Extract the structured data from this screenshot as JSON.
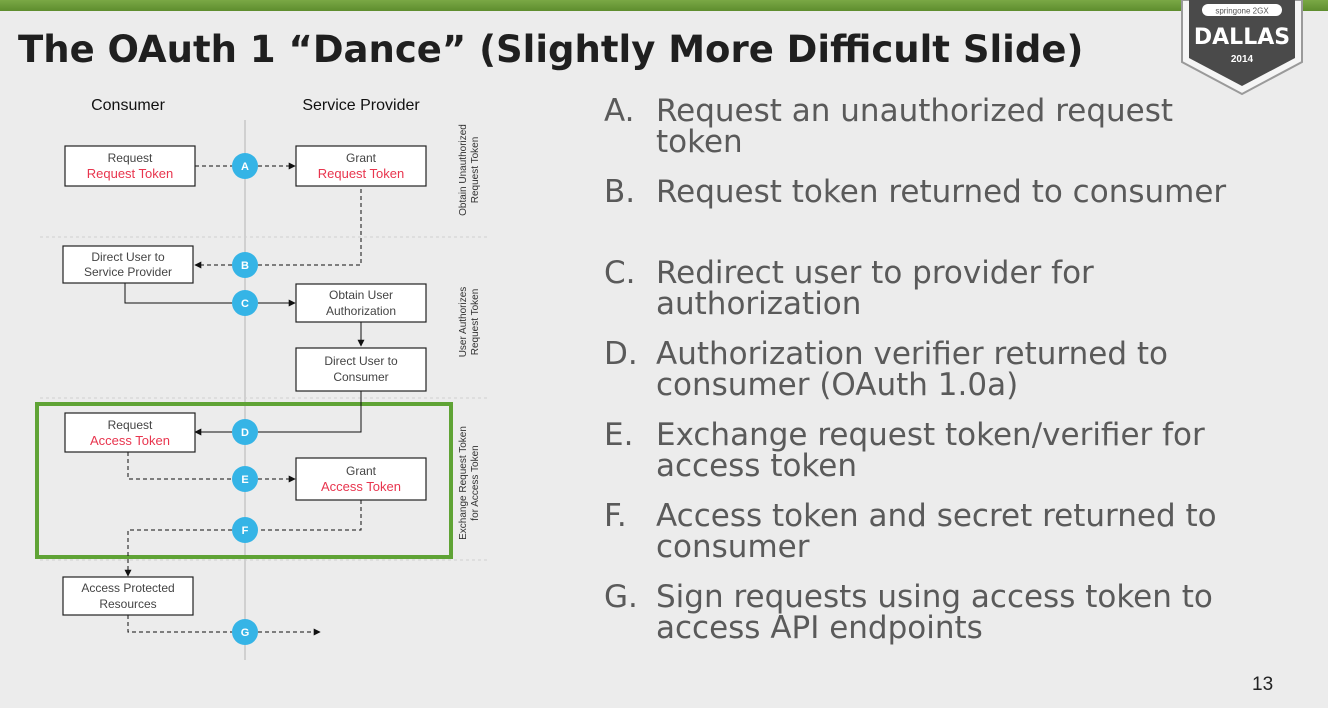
{
  "slide": {
    "title": "The OAuth 1 “Dance” (Slightly More Difficult Slide)",
    "page_number": "13",
    "badge": {
      "top_text": "springone 2GX",
      "city": "DALLAS",
      "year": "2014"
    }
  },
  "diagram": {
    "columns": {
      "left": "Consumer",
      "right": "Service Provider"
    },
    "phases": {
      "obtain": [
        "Obtain Unauthorized",
        "Request Token"
      ],
      "authorize": [
        "User Authorizes",
        "Request Token"
      ],
      "exchange": [
        "Exchange Request Token",
        "for Access Token"
      ]
    },
    "boxes": {
      "request_request_token": [
        "Request",
        "Request Token"
      ],
      "grant_request_token": [
        "Grant",
        "Request Token"
      ],
      "direct_to_sp": [
        "Direct User to",
        "Service Provider"
      ],
      "obtain_authorization": [
        "Obtain User",
        "Authorization"
      ],
      "direct_to_consumer": [
        "Direct User to",
        "Consumer"
      ],
      "request_access_token": [
        "Request",
        "Access Token"
      ],
      "grant_access_token": [
        "Grant",
        "Access Token"
      ],
      "access_resources": [
        "Access Protected",
        "Resources"
      ]
    },
    "steps": [
      "A",
      "B",
      "C",
      "D",
      "E",
      "F",
      "G"
    ]
  },
  "steps_list": [
    {
      "letter": "A.",
      "text": "Request an unauthorized request token"
    },
    {
      "letter": "B.",
      "text": "Request token returned to consumer"
    },
    {
      "letter": "C.",
      "text": "Redirect user to provider for authorization"
    },
    {
      "letter": "D.",
      "text": "Authorization verifier returned to consumer (OAuth 1.0a)"
    },
    {
      "letter": "E.",
      "text": "Exchange request token/verifier for access token"
    },
    {
      "letter": "F.",
      "text": "Access token and secret returned to consumer"
    },
    {
      "letter": "G.",
      "text": "Sign requests using access token to access API endpoints"
    }
  ],
  "colors": {
    "accent_green": "#5fa335",
    "step_circle": "#35b4e6",
    "token_red": "#e8354e",
    "top_bar": "#6c9b3a"
  }
}
